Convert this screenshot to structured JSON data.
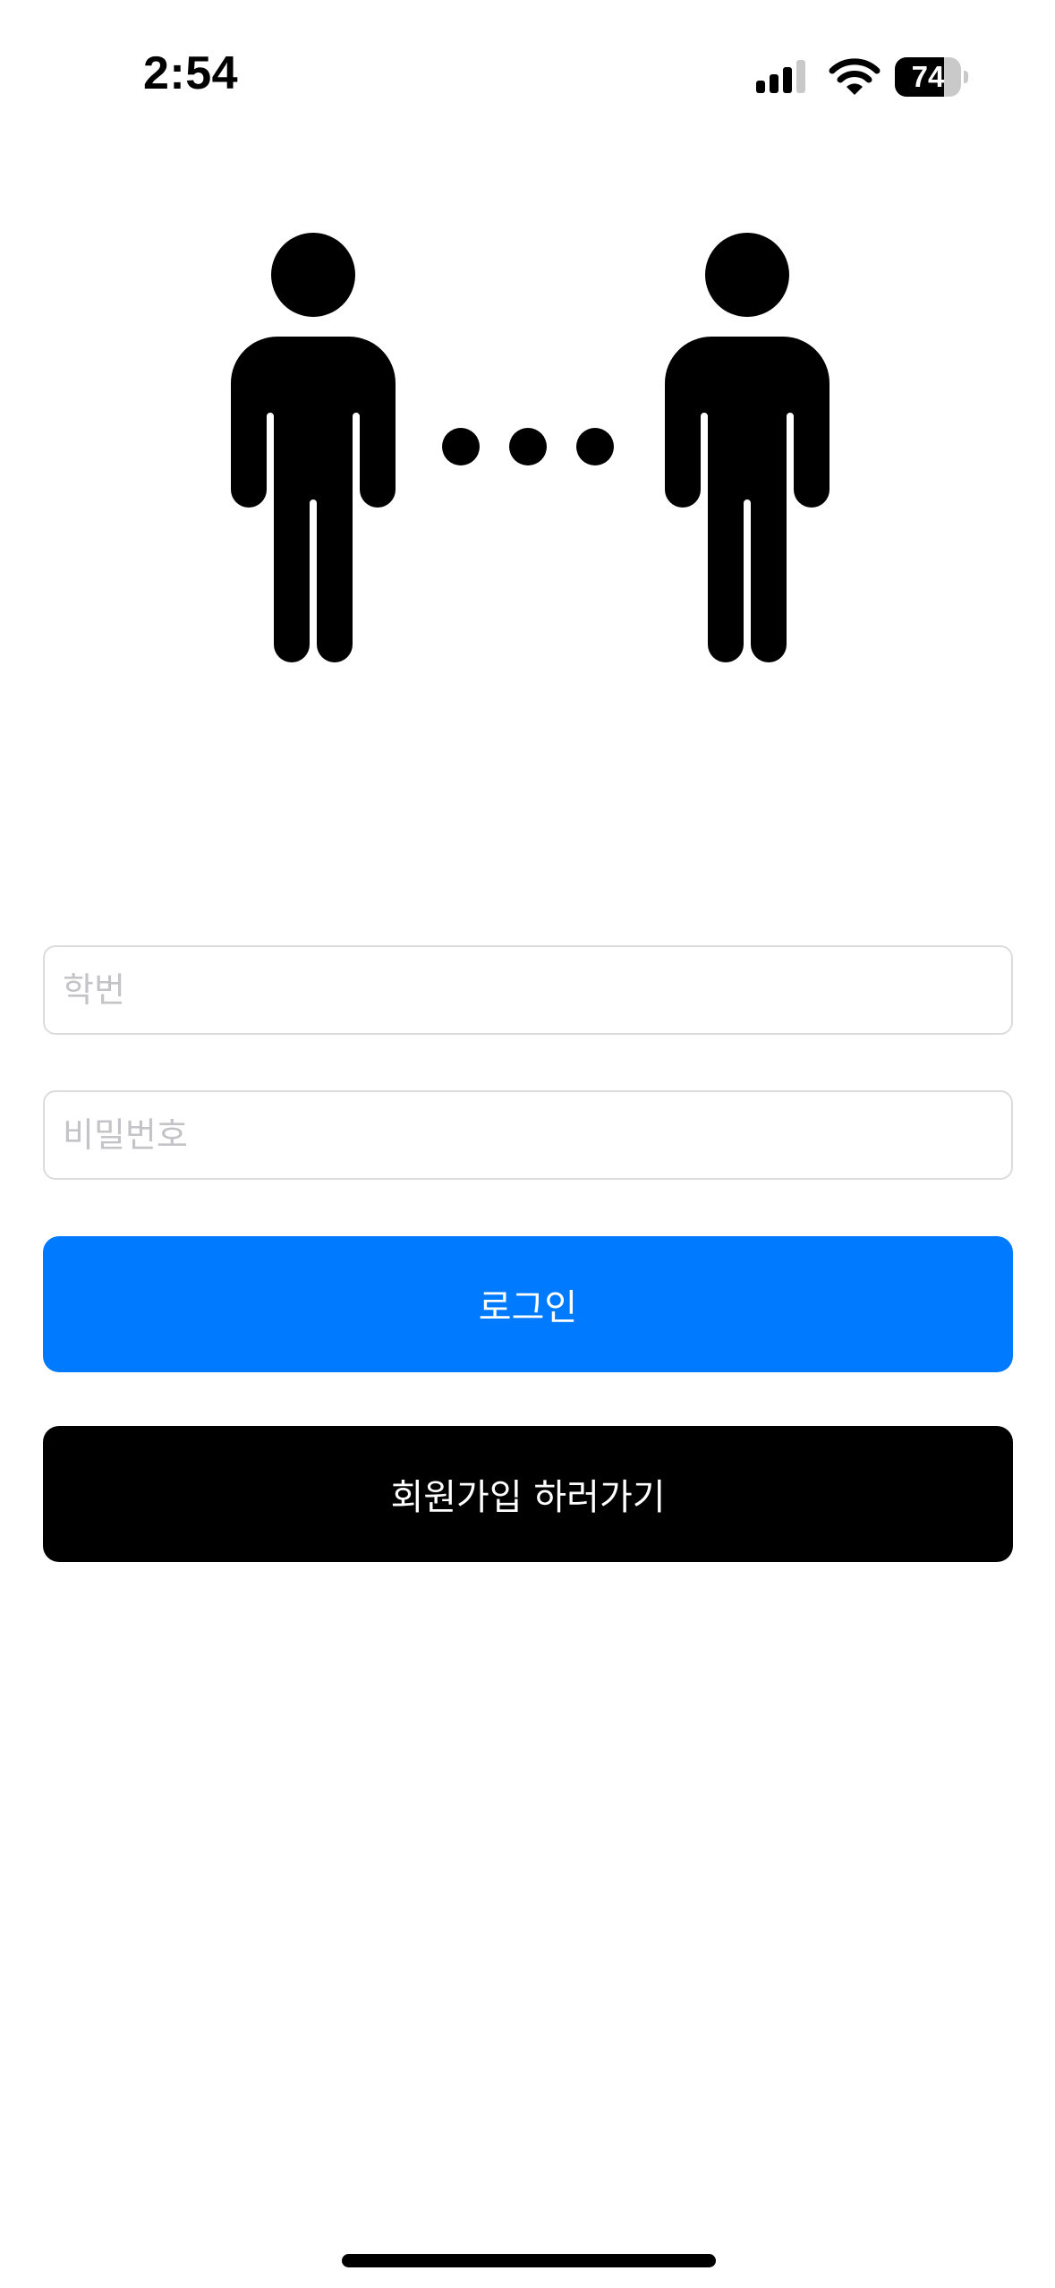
{
  "status_bar": {
    "time": "2:54",
    "battery_level": "74",
    "battery_fraction": 0.74,
    "signal_icon": "cellular-signal-icon",
    "wifi_icon": "wifi-icon"
  },
  "hero": {
    "icon": "two-people-connecting-icon"
  },
  "login_form": {
    "student_id_placeholder": "학번",
    "student_id_value": "",
    "password_placeholder": "비밀번호",
    "password_value": "",
    "login_button_label": "로그인",
    "signup_button_label": "회원가입 하러가기"
  },
  "colors": {
    "accent": "#007aff",
    "signup_button": "#000000",
    "background": "#ffffff",
    "placeholder_text": "#c4c4c8",
    "field_border": "#dcdcdc"
  }
}
